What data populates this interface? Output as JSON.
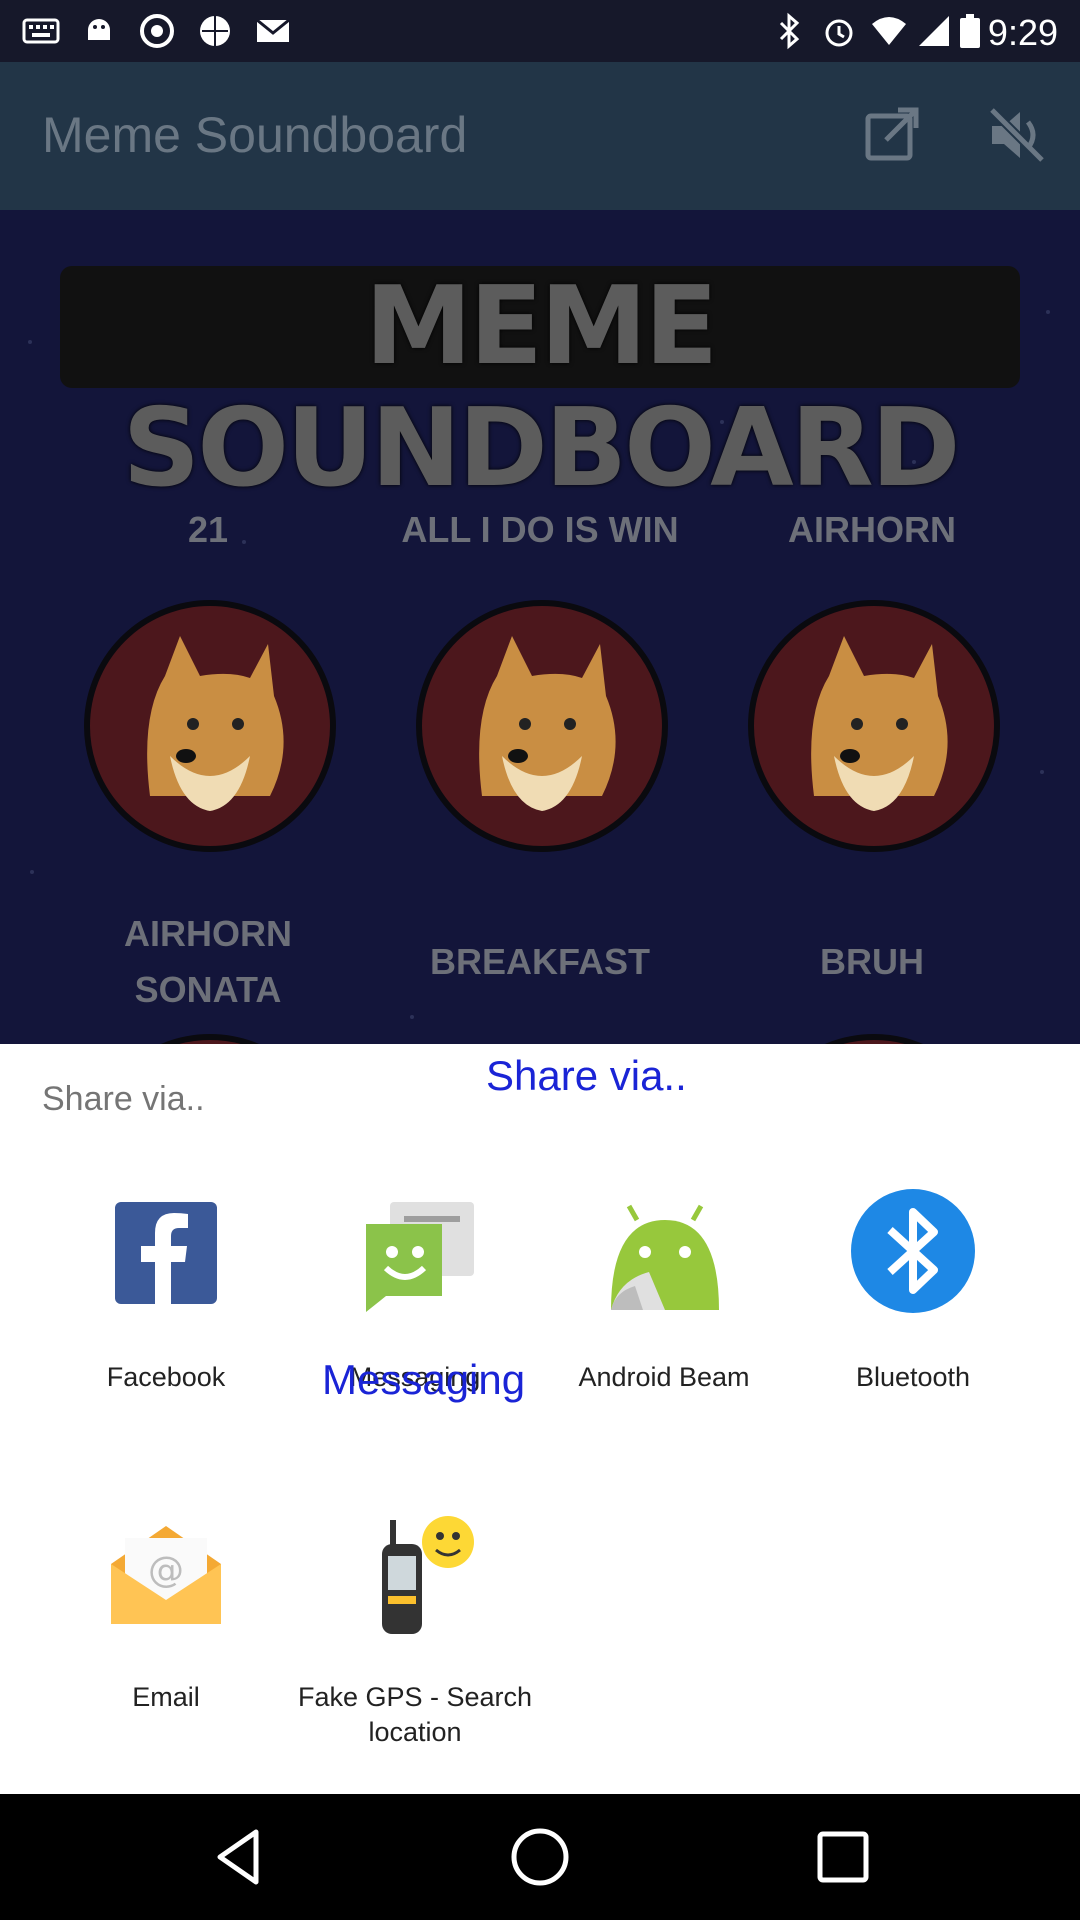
{
  "status_bar": {
    "time": "9:29",
    "icons": [
      "keyboard-icon",
      "android-debug-icon",
      "chrome-icon",
      "globe-icon",
      "gmail-icon",
      "bluetooth-icon",
      "alarm-icon",
      "wifi-icon",
      "signal-icon",
      "battery-icon"
    ]
  },
  "app_bar": {
    "title": "Meme Soundboard",
    "actions": [
      "share-external-icon",
      "volume-off-icon"
    ]
  },
  "content": {
    "banner": "MEME SOUNDBOARD",
    "row1": [
      "21",
      "ALL I DO IS WIN",
      "AIRHORN"
    ],
    "row2": [
      "AIRHORN SONATA",
      "BREAKFAST",
      "BRUH"
    ]
  },
  "share_sheet": {
    "title": "Share via..",
    "overlay_title": "Share via..",
    "apps": [
      {
        "label": "Facebook",
        "icon": "facebook-icon"
      },
      {
        "label": "Messaging",
        "icon": "messaging-icon"
      },
      {
        "label": "Android Beam",
        "icon": "android-beam-icon"
      },
      {
        "label": "Bluetooth",
        "icon": "bluetooth-icon"
      },
      {
        "label": "Email",
        "icon": "email-icon"
      },
      {
        "label": "Fake GPS - Search location",
        "icon": "fake-gps-icon"
      }
    ],
    "overlay_messaging": "Messaging"
  },
  "colors": {
    "accent_overlay_text": "#1a24d6",
    "facebook_blue": "#3b5998",
    "messaging_green": "#8bc34a",
    "android_green": "#97c83c",
    "bluetooth_blue": "#1e88e5"
  },
  "nav_bar": {
    "buttons": [
      "back-icon",
      "home-icon",
      "recents-icon"
    ]
  }
}
